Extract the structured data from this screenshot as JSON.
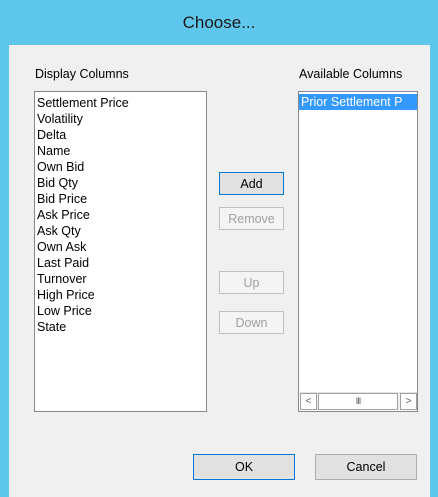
{
  "dialog": {
    "title": "Choose..."
  },
  "display_columns": {
    "label": "Display Columns",
    "items": [
      "Settlement Price",
      "Volatility",
      "Delta",
      "Name",
      "Own Bid",
      "Bid Qty",
      "Bid Price",
      "Ask Price",
      "Ask Qty",
      "Own Ask",
      "Last Paid",
      "Turnover",
      "High Price",
      "Low Price",
      "State"
    ]
  },
  "available_columns": {
    "label": "Available Columns",
    "items": [
      "Prior Settlement P"
    ],
    "selected_index": 0
  },
  "buttons": {
    "add": "Add",
    "remove": "Remove",
    "up": "Up",
    "down": "Down",
    "ok": "OK",
    "cancel": "Cancel"
  },
  "scrollbar": {
    "left_icon": "chevron-left-icon",
    "right_icon": "chevron-right-icon",
    "left_glyph": "<",
    "thumb_glyph": "III",
    "right_glyph": ">"
  },
  "colors": {
    "window_frame": "#60c7ec",
    "selection": "#3399ff"
  }
}
